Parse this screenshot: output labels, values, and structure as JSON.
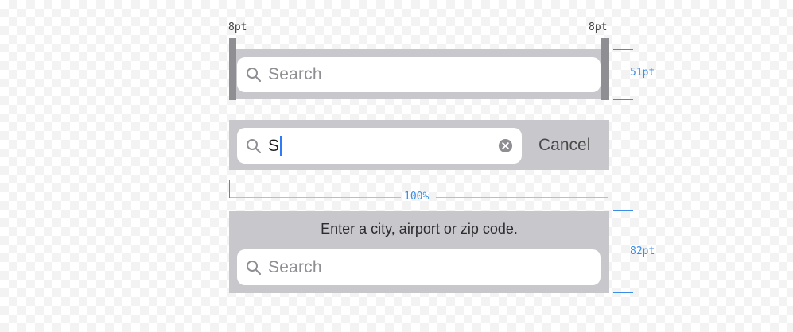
{
  "annotations": {
    "left_margin": "8pt",
    "right_margin": "8pt",
    "bar_height": "51pt",
    "width": "100%",
    "prompt_bar_height": "82pt"
  },
  "default_bar": {
    "placeholder": "Search"
  },
  "active_bar": {
    "typed_text": "S",
    "cancel_label": "Cancel"
  },
  "prompt_bar": {
    "prompt": "Enter a city, airport or zip code.",
    "placeholder": "Search"
  },
  "icons": {
    "search": "magnifying-glass-icon",
    "clear": "clear-circle-x-icon"
  },
  "colors": {
    "bar_background": "#c8c7cc",
    "field_background": "#ffffff",
    "placeholder": "#8e8e93",
    "annotation_blue": "#3a8ee6",
    "caret": "#2f7bf6"
  }
}
